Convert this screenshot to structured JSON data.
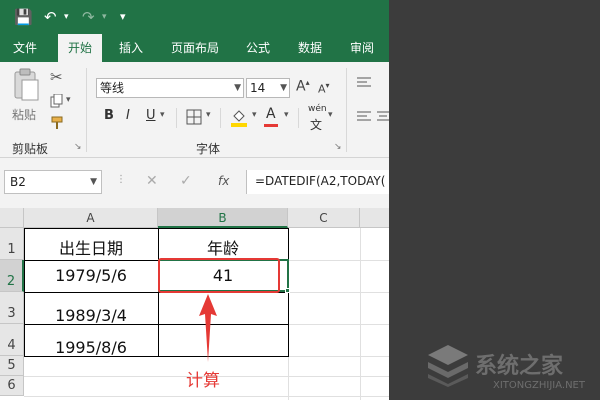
{
  "quick_access": {
    "save": "💾",
    "undo": "↶",
    "redo": "↷",
    "customize": "▾"
  },
  "tabs": [
    "文件",
    "开始",
    "插入",
    "页面布局",
    "公式",
    "数据",
    "审阅"
  ],
  "ribbon": {
    "paste_label": "粘贴",
    "clipboard_group": "剪贴板",
    "font_name": "等线",
    "font_size": "14",
    "font_group": "字体",
    "bold": "B",
    "italic": "I",
    "underline": "U",
    "font_color_letter": "A",
    "phonetic_top": "wén",
    "phonetic_bottom": "文"
  },
  "formula_bar": {
    "name_box": "B2",
    "fx": "fx",
    "formula": "=DATEDIF(A2,TODAY("
  },
  "sheet": {
    "columns": [
      "A",
      "B",
      "C"
    ],
    "rows": [
      "1",
      "2",
      "3",
      "4",
      "5",
      "6"
    ],
    "cells": {
      "A1": "出生日期",
      "B1": "年龄",
      "A2": "1979/5/6",
      "B2": "41",
      "A3": "1989/3/4",
      "A4": "1995/8/6"
    },
    "selected_cell": "B2"
  },
  "annotation": "计算",
  "watermark": {
    "name": "系统之家",
    "url": "XITONGZHIJIA.NET"
  },
  "colors": {
    "excel_green": "#217346",
    "annotation_red": "#e53935",
    "panel_dark": "#3c3c3c"
  }
}
